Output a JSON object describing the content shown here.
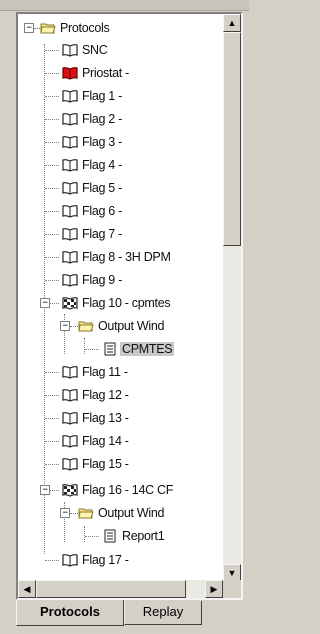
{
  "tree": {
    "root_label": "Protocols",
    "items": [
      {
        "label": "SNC",
        "icon": "book-icon"
      },
      {
        "label": "Priostat -",
        "icon": "red-book-icon"
      },
      {
        "label": "Flag 1 -",
        "icon": "book-icon"
      },
      {
        "label": "Flag 2 -",
        "icon": "book-icon"
      },
      {
        "label": "Flag 3 -",
        "icon": "book-icon"
      },
      {
        "label": "Flag 4 -",
        "icon": "book-icon"
      },
      {
        "label": "Flag 5 -",
        "icon": "book-icon"
      },
      {
        "label": "Flag 6 -",
        "icon": "book-icon"
      },
      {
        "label": "Flag 7 -",
        "icon": "book-icon"
      },
      {
        "label": "Flag 8 - 3H DPM",
        "icon": "book-icon"
      },
      {
        "label": "Flag 9 -",
        "icon": "book-icon"
      },
      {
        "label": "Flag 10 - cpmtes",
        "icon": "checkered-book-icon"
      },
      {
        "label": "Output Wind",
        "icon": "folder-icon"
      },
      {
        "label": "CPMTES",
        "icon": "document-icon"
      },
      {
        "label": "Flag 11 -",
        "icon": "book-icon"
      },
      {
        "label": "Flag 12 -",
        "icon": "book-icon"
      },
      {
        "label": "Flag 13 -",
        "icon": "book-icon"
      },
      {
        "label": "Flag 14 -",
        "icon": "book-icon"
      },
      {
        "label": "Flag 15 -",
        "icon": "book-icon"
      },
      {
        "label": "Flag 16 - 14C CF",
        "icon": "checkered-book-icon"
      },
      {
        "label": "Output Wind",
        "icon": "folder-icon"
      },
      {
        "label": "Report1",
        "icon": "document-icon"
      },
      {
        "label": "Flag 17 -",
        "icon": "book-icon"
      }
    ]
  },
  "tabs": {
    "protocols": "Protocols",
    "replay": "Replay"
  },
  "scroll_glyphs": {
    "up": "▲",
    "down": "▼",
    "left": "◀",
    "right": "▶"
  },
  "expander_glyphs": {
    "collapse": "−"
  }
}
